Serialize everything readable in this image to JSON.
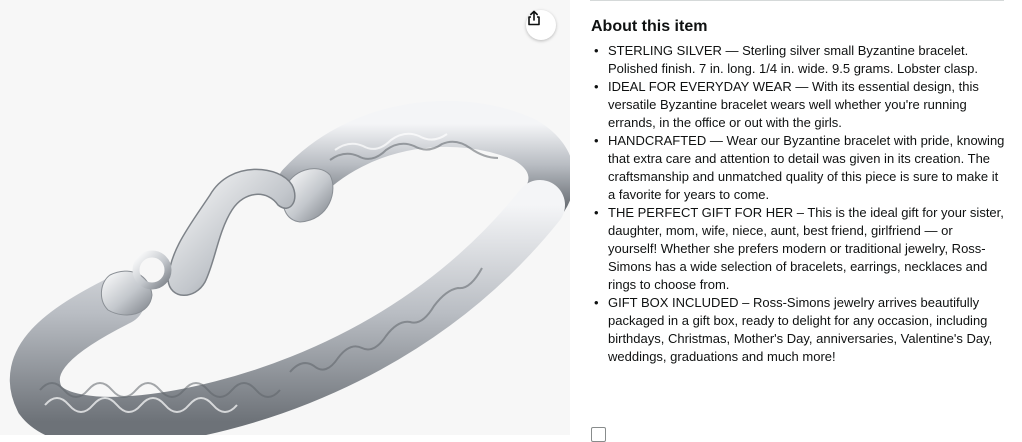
{
  "product_image": {
    "alt": "Sterling silver Byzantine bracelet",
    "share_icon": "share-icon"
  },
  "about": {
    "title": "About this item",
    "bullets": [
      "STERLING SILVER — Sterling silver small Byzantine bracelet. Polished finish. 7 in. long. 1/4 in. wide. 9.5 grams. Lobster clasp.",
      "IDEAL FOR EVERYDAY WEAR — With its essential design, this versatile Byzantine bracelet wears well whether you're running errands, in the office or out with the girls.",
      "HANDCRAFTED — Wear our Byzantine bracelet with pride, knowing that extra care and attention to detail was given in its creation. The craftsmanship and unmatched quality of this piece is sure to make it a favorite for years to come.",
      "THE PERFECT GIFT FOR HER – This is the ideal gift for your sister, daughter, mom, wife, niece, aunt, best friend, girlfriend — or yourself! Whether she prefers modern or traditional jewelry, Ross-Simons has a wide selection of bracelets, earrings, necklaces and rings to choose from.",
      "GIFT BOX INCLUDED – Ross-Simons jewelry arrives beautifully packaged in a gift box, ready to delight for any occasion, including birthdays, Christmas, Mother's Day, anniversaries, Valentine's Day, weddings, graduations and much more!"
    ]
  },
  "colors": {
    "text": "#0f1111",
    "image_bg": "#f7f7f7",
    "silver": "#c9ccd1",
    "rule": "#d5d9d9"
  }
}
